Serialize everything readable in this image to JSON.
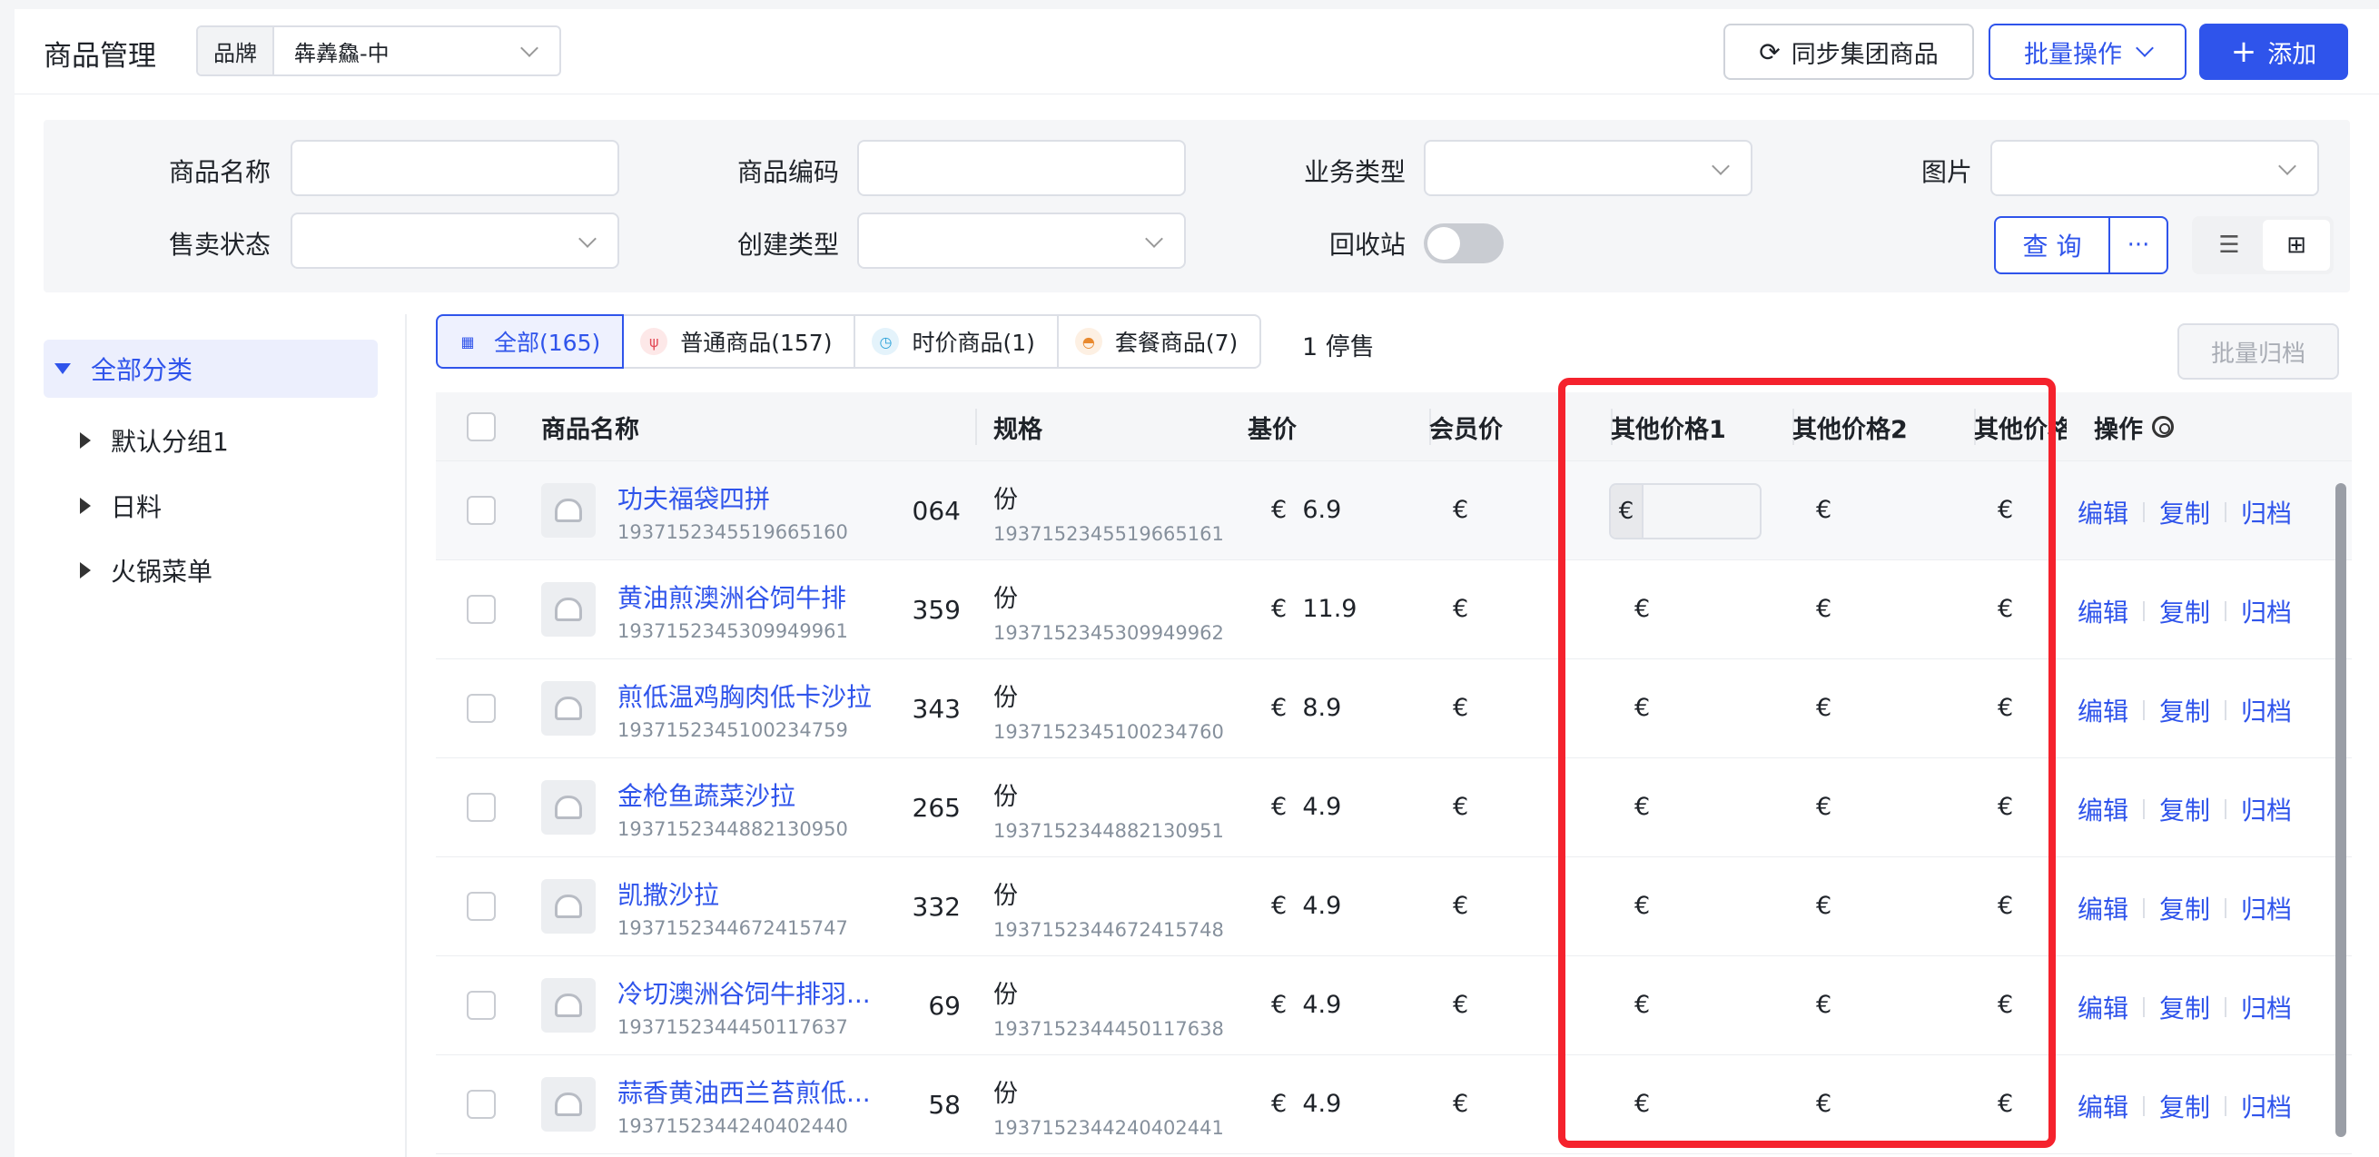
{
  "header": {
    "title": "商品管理",
    "brand_label": "品牌",
    "brand_value": "犇羴鱻-中",
    "sync_label": "同步集团商品",
    "batch_label": "批量操作",
    "add_label": "添加"
  },
  "filters": {
    "name_label": "商品名称",
    "code_label": "商品编码",
    "biz_label": "业务类型",
    "image_label": "图片",
    "sale_label": "售卖状态",
    "create_label": "创建类型",
    "recycle_label": "回收站",
    "query_label": "查 询",
    "more_label": "···"
  },
  "sidebar": {
    "root": "全部分类",
    "items": [
      "默认分组1",
      "日料",
      "火锅菜单"
    ]
  },
  "tabs": [
    {
      "label": "全部(165)"
    },
    {
      "label": "普通商品(157)"
    },
    {
      "label": "时价商品(1)"
    },
    {
      "label": "套餐商品(7)"
    }
  ],
  "stopped_label": "1 停售",
  "archive_all_label": "批量归档",
  "table": {
    "headers": {
      "name": "商品名称",
      "spec": "规格",
      "base": "基价",
      "member": "会员价",
      "other1": "其他价格1",
      "other2": "其他价格2",
      "other3": "其他价格",
      "ops": "操作"
    },
    "currency": "€",
    "ops": {
      "edit": "编辑",
      "copy": "复制",
      "archive": "归档"
    },
    "rows": [
      {
        "name": "功夫福袋四拼",
        "code": "1937152345519665160",
        "clip": "064",
        "spec": "份",
        "spec_code": "1937152345519665161",
        "base": "6.9"
      },
      {
        "name": "黄油煎澳洲谷饲牛排",
        "code": "1937152345309949961",
        "clip": "359",
        "spec": "份",
        "spec_code": "1937152345309949962",
        "base": "11.9"
      },
      {
        "name": "煎低温鸡胸肉低卡沙拉",
        "code": "1937152345100234759",
        "clip": "343",
        "spec": "份",
        "spec_code": "1937152345100234760",
        "base": "8.9"
      },
      {
        "name": "金枪鱼蔬菜沙拉",
        "code": "1937152344882130950",
        "clip": "265",
        "spec": "份",
        "spec_code": "1937152344882130951",
        "base": "4.9"
      },
      {
        "name": "凯撒沙拉",
        "code": "1937152344672415747",
        "clip": "332",
        "spec": "份",
        "spec_code": "1937152344672415748",
        "base": "4.9"
      },
      {
        "name": "冷切澳洲谷饲牛排羽...",
        "code": "1937152344450117637",
        "clip": "69",
        "spec": "份",
        "spec_code": "1937152344450117638",
        "base": "4.9"
      },
      {
        "name": "蒜香黄油西兰苔煎低...",
        "code": "1937152344240402440",
        "clip": "58",
        "spec": "份",
        "spec_code": "1937152344240402441",
        "base": "4.9"
      }
    ]
  },
  "colors": {
    "accent": "#2f54eb",
    "highlight_box": "#f5222d"
  }
}
